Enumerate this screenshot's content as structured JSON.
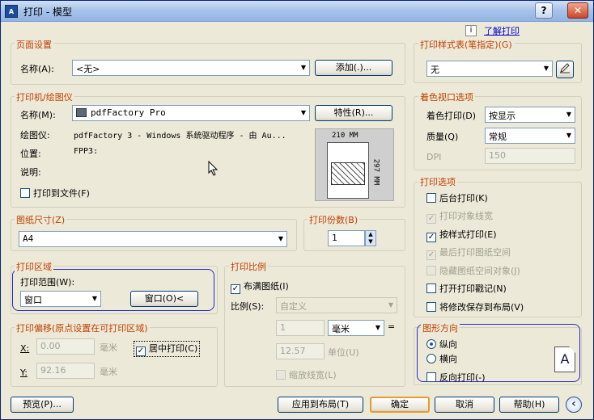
{
  "window": {
    "title": "打印 - 模型",
    "app_icon_text": "A",
    "help_btn": "?",
    "close_btn": "✕"
  },
  "help_link": {
    "icon": "info-icon",
    "text": "了解打印"
  },
  "page_setup": {
    "title": "页面设置",
    "name_label": "名称(A):",
    "name_value": "<无>",
    "add_button": "添加(.)..."
  },
  "printer": {
    "title": "打印机/绘图仪",
    "name_label": "名称(M):",
    "name_value": "pdfFactory Pro",
    "properties_button": "特性(R)...",
    "plotter_label": "绘图仪:",
    "plotter_value": "pdfFactory 3 - Windows 系统驱动程序 - 由 Au...",
    "location_label": "位置:",
    "location_value": "FPP3:",
    "description_label": "说明:",
    "print_to_file": "打印到文件(F)",
    "preview_width": "210 MM",
    "preview_height": "297 MM"
  },
  "paper_size": {
    "title": "图纸尺寸(Z)",
    "value": "A4"
  },
  "copies": {
    "title": "打印份数(B)",
    "value": "1"
  },
  "plot_area": {
    "title": "打印区域",
    "range_label": "打印范围(W):",
    "range_value": "窗口",
    "window_button": "窗口(O)<"
  },
  "plot_offset": {
    "title": "打印偏移(原点设置在可打印区域)",
    "x_label": "X:",
    "x_value": "0.00",
    "x_unit": "毫米",
    "y_label": "Y:",
    "y_value": "92.16",
    "y_unit": "毫米",
    "center_label": "居中打印(C)",
    "center_checked": true
  },
  "plot_scale": {
    "title": "打印比例",
    "fit_label": "布满图纸(I)",
    "fit_checked": true,
    "scale_label": "比例(S):",
    "scale_value": "自定义",
    "value1": "1",
    "unit1": "毫米",
    "eq": "=",
    "value2": "12.57",
    "unit2": "单位(U)",
    "lineweight_label": "缩放线宽(L)"
  },
  "plot_style": {
    "title": "打印样式表(笔指定)(G)",
    "value": "无"
  },
  "shaded_viewport": {
    "title": "着色视口选项",
    "shade_label": "着色打印(D)",
    "shade_value": "按显示",
    "quality_label": "质量(Q)",
    "quality_value": "常规",
    "dpi_label": "DPI",
    "dpi_value": "150"
  },
  "plot_options": {
    "title": "打印选项",
    "items": [
      {
        "label": "后台打印(K)",
        "checked": false,
        "disabled": false
      },
      {
        "label": "打印对象线宽",
        "checked": true,
        "disabled": true
      },
      {
        "label": "按样式打印(E)",
        "checked": true,
        "disabled": false
      },
      {
        "label": "最后打印图纸空间",
        "checked": true,
        "disabled": true
      },
      {
        "label": "隐藏图纸空间对象(J)",
        "checked": false,
        "disabled": true
      },
      {
        "label": "打开打印戳记(N)",
        "checked": false,
        "disabled": false
      },
      {
        "label": "将修改保存到布局(V)",
        "checked": false,
        "disabled": false
      }
    ]
  },
  "orientation": {
    "title": "图形方向",
    "portrait": "纵向",
    "landscape": "横向",
    "upside_down": "反向打印(-)",
    "icon_letter": "A"
  },
  "footer": {
    "preview": "预览(P)...",
    "apply": "应用到布局(T)",
    "ok": "确定",
    "cancel": "取消",
    "help": "帮助(H)",
    "collapse_icon": "‹"
  }
}
